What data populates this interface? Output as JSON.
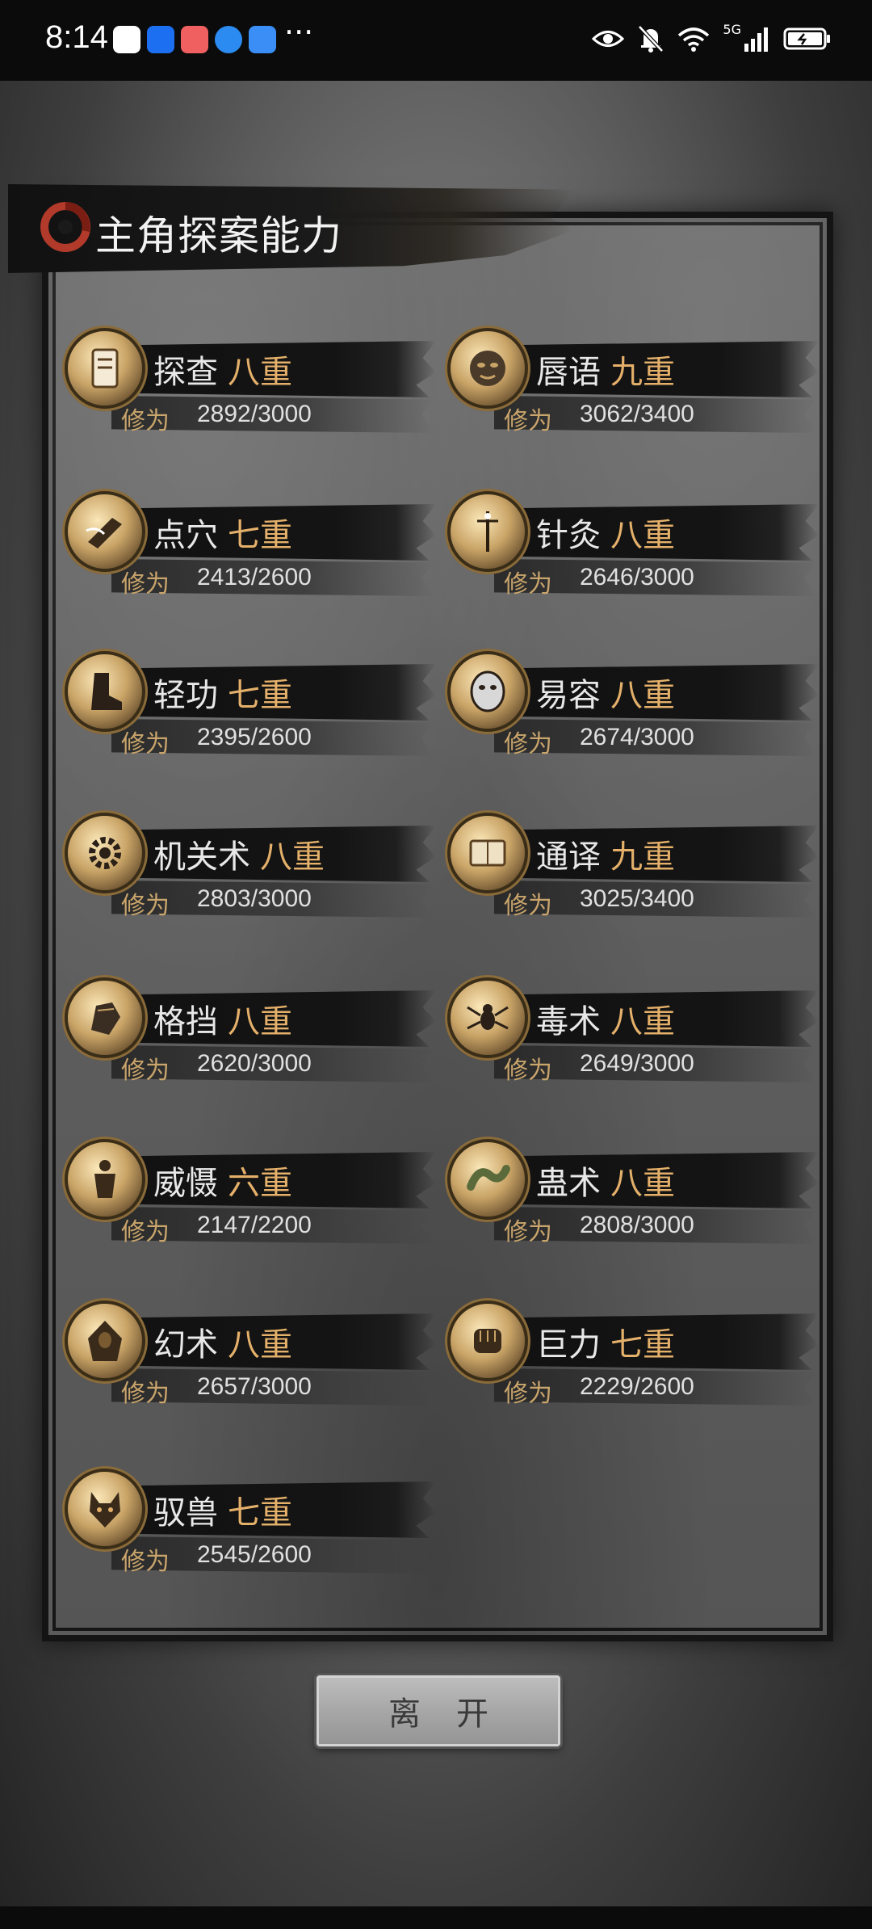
{
  "status_bar": {
    "time": "8:14",
    "more": "···",
    "network": "5G"
  },
  "title": "主角探案能力",
  "xp_label": "修为",
  "skills": [
    {
      "name": "探查",
      "level": "八重",
      "xp": "2892/3000",
      "icon": "scroll-icon"
    },
    {
      "name": "唇语",
      "level": "九重",
      "xp": "3062/3400",
      "icon": "mask-face-icon"
    },
    {
      "name": "点穴",
      "level": "七重",
      "xp": "2413/2600",
      "icon": "strike-hand-icon"
    },
    {
      "name": "针灸",
      "level": "八重",
      "xp": "2646/3000",
      "icon": "needle-icon"
    },
    {
      "name": "轻功",
      "level": "七重",
      "xp": "2395/2600",
      "icon": "boot-icon"
    },
    {
      "name": "易容",
      "level": "八重",
      "xp": "2674/3000",
      "icon": "disguise-mask-icon"
    },
    {
      "name": "机关术",
      "level": "八重",
      "xp": "2803/3000",
      "icon": "gear-icon"
    },
    {
      "name": "通译",
      "level": "九重",
      "xp": "3025/3400",
      "icon": "book-scroll-icon"
    },
    {
      "name": "格挡",
      "level": "八重",
      "xp": "2620/3000",
      "icon": "gauntlet-icon"
    },
    {
      "name": "毒术",
      "level": "八重",
      "xp": "2649/3000",
      "icon": "spider-icon"
    },
    {
      "name": "威慑",
      "level": "六重",
      "xp": "2147/2200",
      "icon": "warrior-icon"
    },
    {
      "name": "蛊术",
      "level": "八重",
      "xp": "2808/3000",
      "icon": "worm-icon"
    },
    {
      "name": "幻术",
      "level": "八重",
      "xp": "2657/3000",
      "icon": "hooded-figure-icon"
    },
    {
      "name": "巨力",
      "level": "七重",
      "xp": "2229/2600",
      "icon": "fist-icon"
    },
    {
      "name": "驭兽",
      "level": "七重",
      "xp": "2545/2600",
      "icon": "wolf-icon"
    }
  ],
  "leave_button": "离开"
}
